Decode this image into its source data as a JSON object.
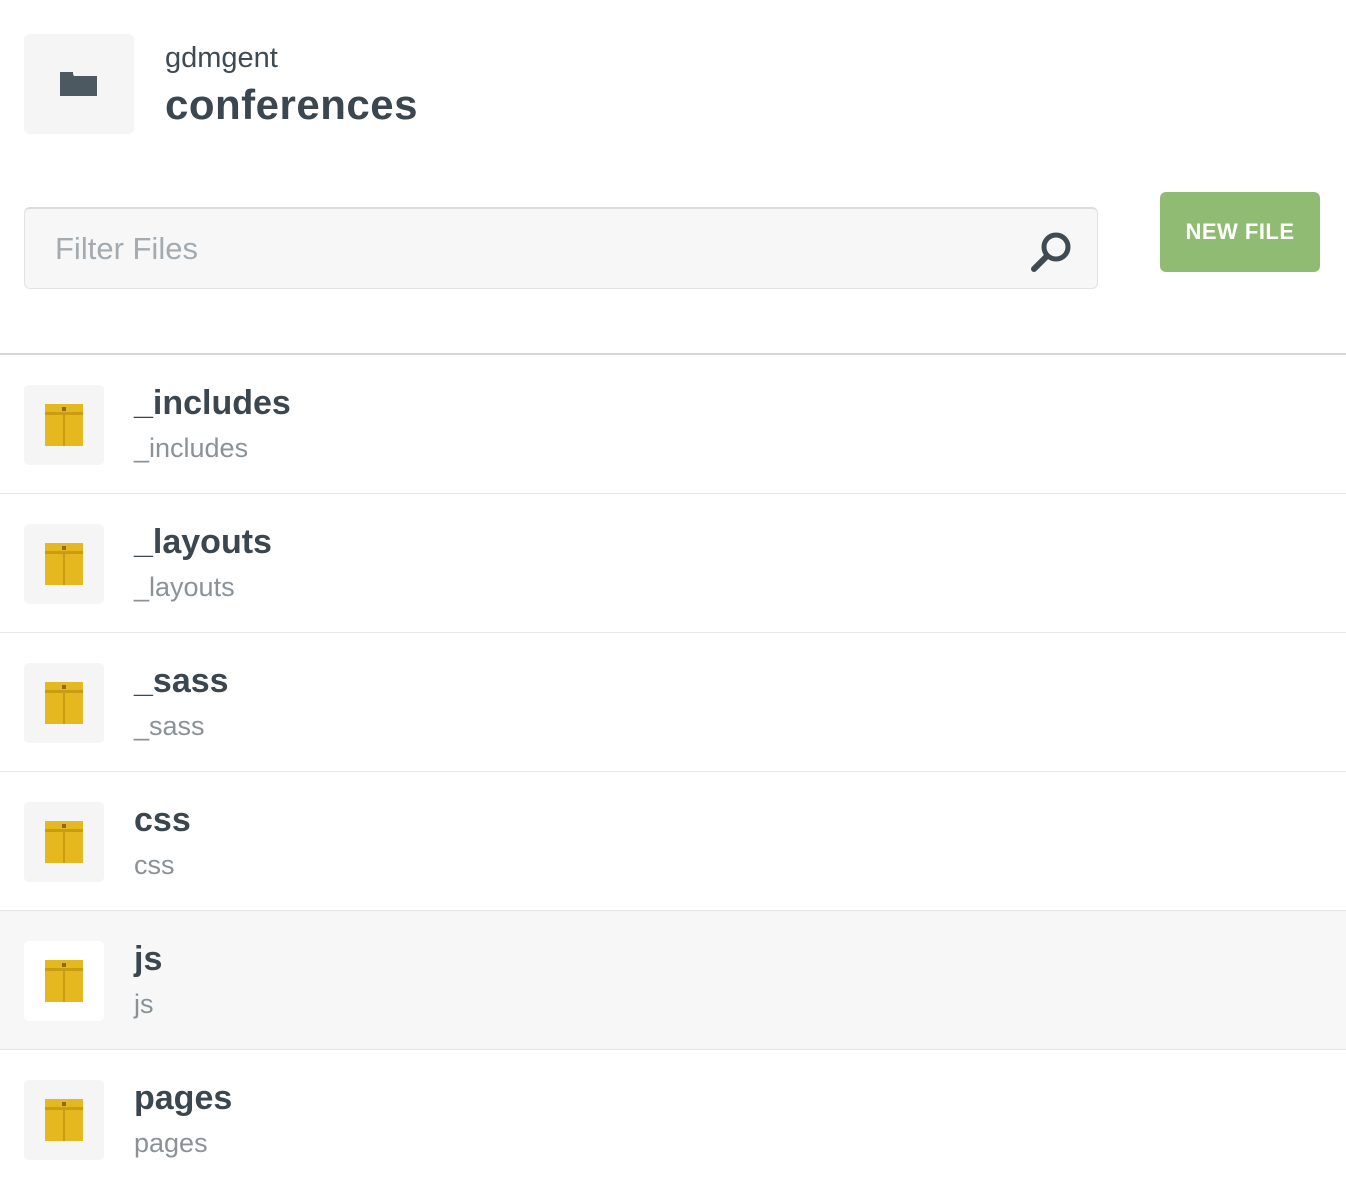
{
  "header": {
    "owner": "gdmgent",
    "repo_name": "conferences",
    "icon": "folder-icon"
  },
  "toolbar": {
    "filter_placeholder": "Filter Files",
    "filter_value": "",
    "search_icon": "search-icon",
    "new_file_label": "NEW FILE",
    "new_file_color": "#8fbb72"
  },
  "files": {
    "items": [
      {
        "name": "_includes",
        "path": "_includes",
        "icon": "folder-icon"
      },
      {
        "name": "_layouts",
        "path": "_layouts",
        "icon": "folder-icon"
      },
      {
        "name": "_sass",
        "path": "_sass",
        "icon": "folder-icon"
      },
      {
        "name": "css",
        "path": "css",
        "icon": "folder-icon"
      },
      {
        "name": "js",
        "path": "js",
        "icon": "folder-icon",
        "highlighted": true
      },
      {
        "name": "pages",
        "path": "pages",
        "icon": "folder-icon"
      }
    ],
    "folder_color": "#e6b820"
  }
}
